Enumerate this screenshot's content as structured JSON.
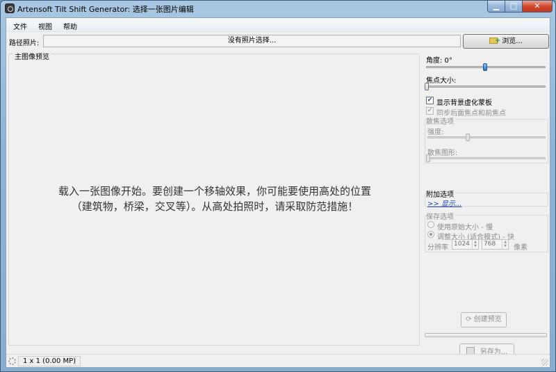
{
  "window": {
    "title": "Artensoft Tilt Shift Generator: 选择一张图片编辑"
  },
  "menu": {
    "items": [
      "文件",
      "视图",
      "帮助"
    ]
  },
  "path": {
    "label": "路径照片:",
    "value": "没有照片选择...",
    "browse_label": "浏览..."
  },
  "preview": {
    "title": "主图像预览",
    "message_line1": "载入一张图像开始。要创建一个移轴效果，你可能要使用高处的位置",
    "message_line2": "（建筑物，桥梁，交叉等）。从高处拍照时，请采取防范措施！"
  },
  "panel": {
    "angle_label": "角度: 0°",
    "angle_value": 0,
    "focus_size_label": "焦点大小:",
    "show_mask_label": "显示背景虚化蒙板",
    "show_mask_checked": true,
    "sync_label": "同步后面焦点和前焦点",
    "sync_checked": true,
    "blur": {
      "title": "散焦选项",
      "strength_label": "强度:",
      "shape_label": "散焦图形:"
    },
    "extra": {
      "title": "附加选项",
      "show_link": ">> 显示..."
    },
    "save": {
      "title": "保存选项",
      "option_original": "使用原始大小 - 慢",
      "option_resize": "调整大小 (适合模式) - 快",
      "selected": "option_resize",
      "resolution_label": "分辨率",
      "width": "1024",
      "height": "768",
      "unit": "像素"
    },
    "create_preview_label": "创建预览",
    "save_as_label": "另存为..."
  },
  "status": {
    "size": "1 x 1 (0.00 MP)"
  },
  "colors": {
    "link": "#2446a9",
    "active_thumb": "#2a6fc7",
    "title_gradient": "#a9c7e2"
  }
}
